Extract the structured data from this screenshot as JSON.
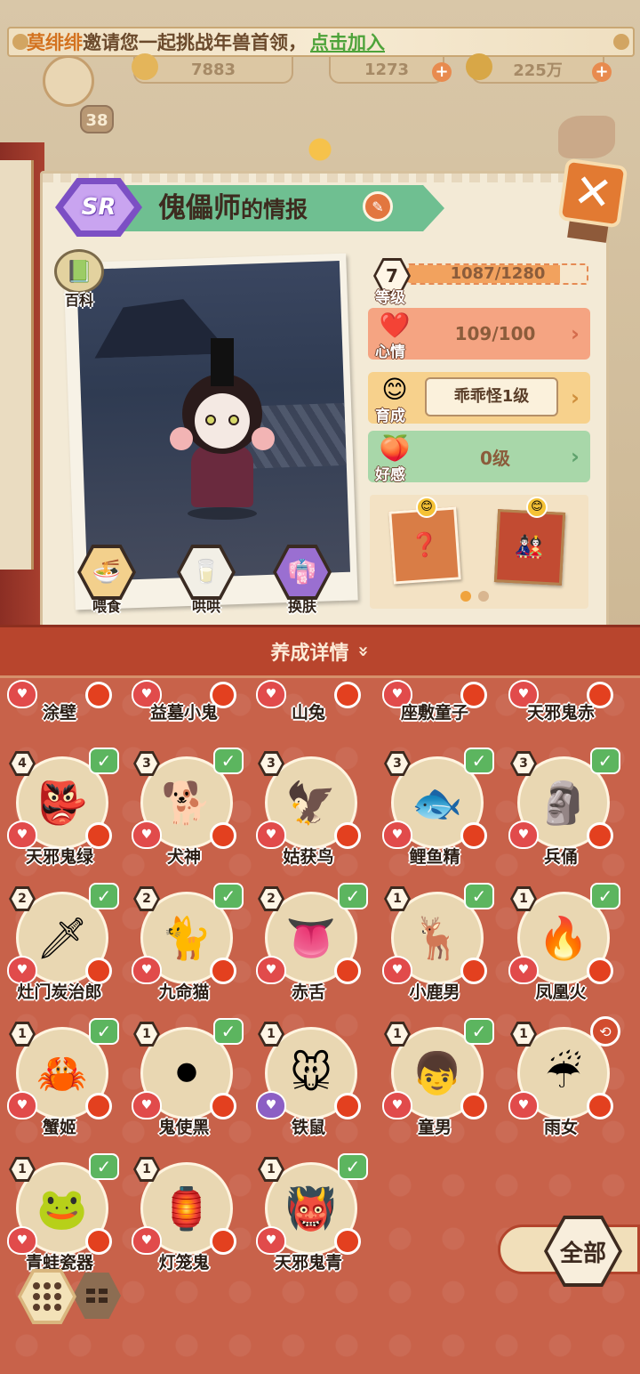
{
  "banner": {
    "inviter": "莫绯绯",
    "message": "邀请您一起挑战年兽首领，",
    "link": "点击加入"
  },
  "resources": {
    "res1": "7883",
    "res2": "1273",
    "res3": "225万"
  },
  "player": {
    "level": "38"
  },
  "info": {
    "rarity": "SR",
    "name": "傀儡师",
    "name_suffix": "的情报",
    "wiki_label": "百科",
    "level": "7",
    "level_label": "等级",
    "exp_text": "1087/1280",
    "exp_fraction": 0.849,
    "mood_label": "心情",
    "mood_value": "109/100",
    "train_label": "育成",
    "train_value": "乖乖怪1级",
    "affinity_label": "好感",
    "affinity_value": "0级",
    "actions": {
      "feed": "喂食",
      "coax": "哄哄",
      "skin": "换肤"
    }
  },
  "section": {
    "title": "养成详情"
  },
  "partial_row": [
    {
      "name": "涂壁",
      "icon": "🧱"
    },
    {
      "name": "益墓小鬼",
      "icon": "👻"
    },
    {
      "name": "山兔",
      "icon": "🐰"
    },
    {
      "name": "座敷童子",
      "icon": "🏮"
    },
    {
      "name": "天邪鬼赤",
      "icon": "👹"
    }
  ],
  "shikigami": [
    {
      "name": "天邪鬼绿",
      "level": "4",
      "icon": "👺",
      "checked": true
    },
    {
      "name": "犬神",
      "level": "3",
      "icon": "🐕",
      "checked": true
    },
    {
      "name": "姑获鸟",
      "level": "3",
      "icon": "🦅",
      "checked": false
    },
    {
      "name": "鲤鱼精",
      "level": "3",
      "icon": "🐟",
      "checked": true
    },
    {
      "name": "兵俑",
      "level": "3",
      "icon": "🗿",
      "checked": true
    },
    {
      "name": "灶门炭治郎",
      "level": "2",
      "icon": "🗡",
      "checked": true
    },
    {
      "name": "九命猫",
      "level": "2",
      "icon": "🐈",
      "checked": true
    },
    {
      "name": "赤舌",
      "level": "2",
      "icon": "👅",
      "checked": true
    },
    {
      "name": "小鹿男",
      "level": "1",
      "icon": "🦌",
      "checked": true
    },
    {
      "name": "凤凰火",
      "level": "1",
      "icon": "🔥",
      "checked": true
    },
    {
      "name": "蟹姬",
      "level": "1",
      "icon": "🦀",
      "checked": true
    },
    {
      "name": "鬼使黑",
      "level": "1",
      "icon": "⚫",
      "checked": true
    },
    {
      "name": "铁鼠",
      "level": "1",
      "icon": "🐭",
      "checked": false
    },
    {
      "name": "童男",
      "level": "1",
      "icon": "👦",
      "checked": true
    },
    {
      "name": "雨女",
      "level": "1",
      "icon": "☔",
      "checked": false,
      "alt_badge": true
    },
    {
      "name": "青蛙瓷器",
      "level": "1",
      "icon": "🐸",
      "checked": true
    },
    {
      "name": "灯笼鬼",
      "level": "1",
      "icon": "🏮",
      "checked": false
    },
    {
      "name": "天邪鬼青",
      "level": "1",
      "icon": "👹",
      "checked": true
    }
  ],
  "controls": {
    "all_label": "全部"
  },
  "colors": {
    "accent_red": "#c8624a",
    "check_green": "#5cb55f",
    "sr_purple": "#7c4fc4"
  }
}
